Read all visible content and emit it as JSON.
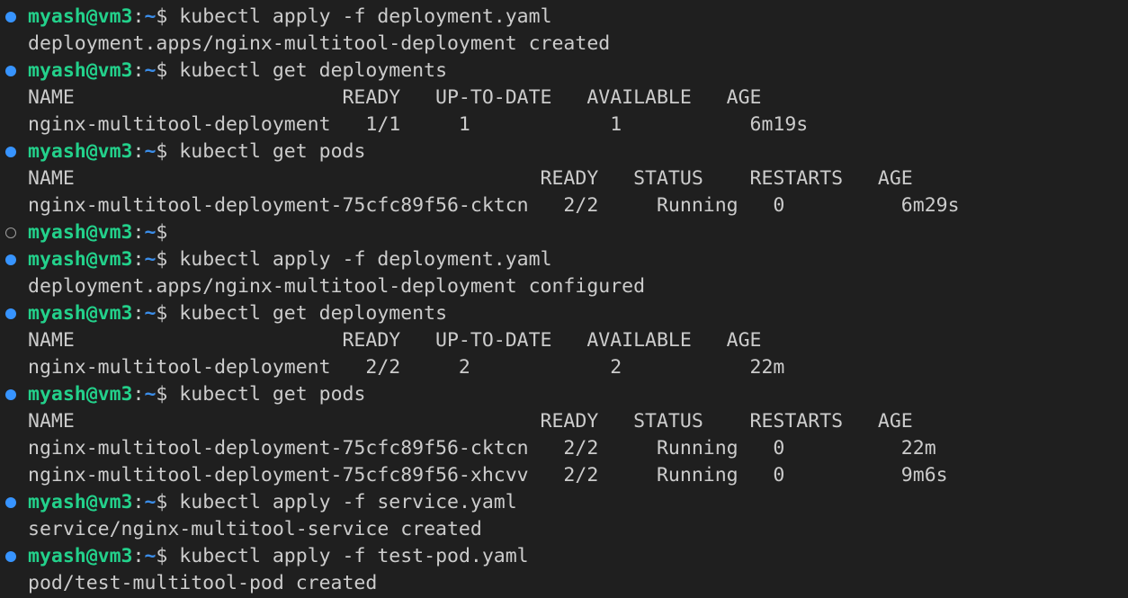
{
  "colors": {
    "background": "#1f1f1f",
    "text": "#cccccc",
    "prompt_user": "#23d18b",
    "prompt_path": "#3b8eea",
    "decoration_success": "#3794ff",
    "decoration_empty": "#9d9d9d"
  },
  "prompt": {
    "user": "myash@vm3",
    "sep": ":",
    "path": "~",
    "dollar": "$"
  },
  "lines": [
    {
      "type": "cmd",
      "status": "success",
      "text": " kubectl apply -f deployment.yaml"
    },
    {
      "type": "out",
      "text": "deployment.apps/nginx-multitool-deployment created"
    },
    {
      "type": "cmd",
      "status": "success",
      "text": " kubectl get deployments"
    },
    {
      "type": "out",
      "text": "NAME                       READY   UP-TO-DATE   AVAILABLE   AGE"
    },
    {
      "type": "out",
      "text": "nginx-multitool-deployment   1/1     1            1           6m19s"
    },
    {
      "type": "cmd",
      "status": "success",
      "text": " kubectl get pods"
    },
    {
      "type": "out",
      "text": "NAME                                        READY   STATUS    RESTARTS   AGE"
    },
    {
      "type": "out",
      "text": "nginx-multitool-deployment-75cfc89f56-cktcn   2/2     Running   0          6m29s"
    },
    {
      "type": "cmd",
      "status": "empty",
      "text": ""
    },
    {
      "type": "cmd",
      "status": "success",
      "text": " kubectl apply -f deployment.yaml"
    },
    {
      "type": "out",
      "text": "deployment.apps/nginx-multitool-deployment configured"
    },
    {
      "type": "cmd",
      "status": "success",
      "text": " kubectl get deployments"
    },
    {
      "type": "out",
      "text": "NAME                       READY   UP-TO-DATE   AVAILABLE   AGE"
    },
    {
      "type": "out",
      "text": "nginx-multitool-deployment   2/2     2            2           22m"
    },
    {
      "type": "cmd",
      "status": "success",
      "text": " kubectl get pods"
    },
    {
      "type": "out",
      "text": "NAME                                        READY   STATUS    RESTARTS   AGE"
    },
    {
      "type": "out",
      "text": "nginx-multitool-deployment-75cfc89f56-cktcn   2/2     Running   0          22m"
    },
    {
      "type": "out",
      "text": "nginx-multitool-deployment-75cfc89f56-xhcvv   2/2     Running   0          9m6s"
    },
    {
      "type": "cmd",
      "status": "success",
      "text": " kubectl apply -f service.yaml"
    },
    {
      "type": "out",
      "text": "service/nginx-multitool-service created"
    },
    {
      "type": "cmd",
      "status": "success",
      "text": " kubectl apply -f test-pod.yaml"
    },
    {
      "type": "out",
      "text": "pod/test-multitool-pod created"
    }
  ]
}
